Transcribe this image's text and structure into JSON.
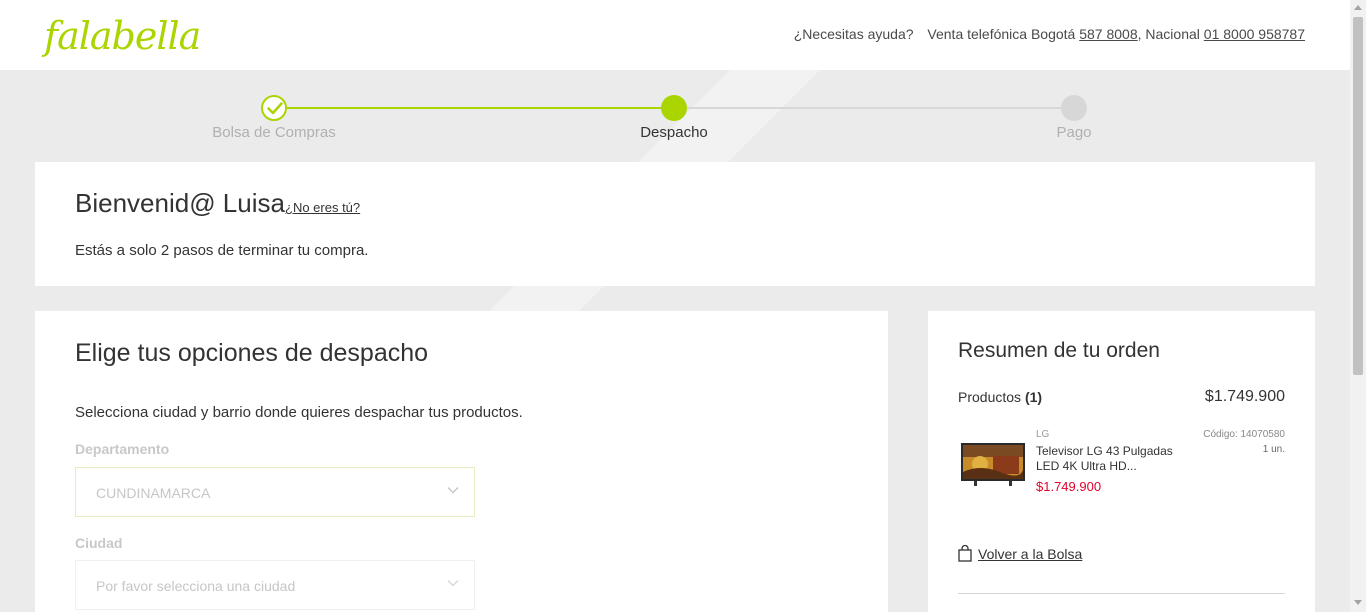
{
  "header": {
    "logo": "falabella",
    "help_label": "¿Necesitas ayuda?",
    "phone_prefix": "Venta telefónica Bogotá",
    "phone_bogota": "587 8008",
    "national_prefix": ", Nacional",
    "phone_national": "01 8000 958787"
  },
  "stepper": {
    "steps": [
      {
        "label": "Bolsa de Compras",
        "state": "completed"
      },
      {
        "label": "Despacho",
        "state": "active"
      },
      {
        "label": "Pago",
        "state": "pending"
      }
    ]
  },
  "welcome": {
    "greeting": "Bienvenid@ Luisa",
    "not_you": "¿No eres tú?",
    "subtitle": "Estás a solo 2 pasos de terminar tu compra."
  },
  "dispatch": {
    "title": "Elige tus opciones de despacho",
    "description": "Selecciona ciudad y barrio donde quieres despachar tus productos.",
    "department_label": "Departamento",
    "department_value": "CUNDINAMARCA",
    "city_label": "Ciudad",
    "city_placeholder": "Por favor selecciona una ciudad"
  },
  "summary": {
    "title": "Resumen de tu orden",
    "products_label": "Productos",
    "products_count": "(1)",
    "total": "$1.749.900",
    "item": {
      "brand": "LG",
      "code": "Código: 14070580",
      "name": "Televisor LG 43 Pulgadas LED 4K Ultra HD...",
      "quantity": "1 un.",
      "price": "$1.749.900"
    },
    "back_link": "Volver a la Bolsa"
  },
  "colors": {
    "accent": "#aad500",
    "price": "#e4002b",
    "background": "#ebebeb"
  }
}
